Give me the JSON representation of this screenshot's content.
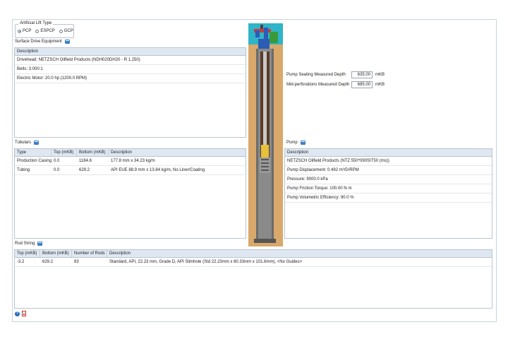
{
  "lift_type": {
    "title": "Artificial Lift Type",
    "options": [
      {
        "label": "PCP",
        "selected": true
      },
      {
        "label": "ESPCP",
        "selected": false
      },
      {
        "label": "GCP",
        "selected": false
      }
    ]
  },
  "surface": {
    "title": "Surface Drive Equipment",
    "header": "Description",
    "rows": [
      "Drivehead: NETZSCH Oilfield Products (NDH020DH20 - R 1.250)",
      "Belts: 3.000:1",
      "Electric Motor: 20.0 hp (1200.0 RPM)"
    ]
  },
  "depths": {
    "pump_seating": {
      "label": "Pump Seating Measured Depth",
      "value": "635.00",
      "unit": "mKB"
    },
    "mid_perf": {
      "label": "Mid-perforations Measured Depth",
      "value": "685.00",
      "unit": "mKB"
    }
  },
  "tubulars": {
    "title": "Tubulars",
    "headers": [
      "Type",
      "Top (mKB)",
      "Bottom (mKB)",
      "Description"
    ],
    "rows": [
      [
        "Production Casing",
        "0.0",
        "1184.6",
        "177.8 mm x 34.23 kg/m"
      ],
      [
        "Tubing",
        "0.0",
        "629.2",
        "API EUE 88.9 mm x 13.84 kg/m, No Liner/Coating"
      ]
    ]
  },
  "pump": {
    "title": "Pump",
    "header": "Description",
    "rows": [
      "NETZSCH Oilfield Products (NTZ 550*090SIT50 (ms))",
      "Pump Displacement: 0.492 m³/D/RPM",
      "Pressure: 9000.0 kPa",
      "Pump Friction Torque: 100.00 N·m",
      "Pump Volumetric Efficiency: 90.0 %"
    ]
  },
  "rod_string": {
    "title": "Rod String",
    "headers": [
      "Top (mKB)",
      "Bottom (mKB)",
      "Number of Rods",
      "Description"
    ],
    "rows": [
      [
        "-3.2",
        "629.2",
        "83",
        "Standard, API, 22.23 mm, Grade D, API Slimhole (Std 22.23mm x 60.33mm x 101.6mm), <No Guides>"
      ]
    ]
  },
  "icons": {
    "help": "help-icon",
    "pdf": "pdf-icon",
    "edit": "edit-icon"
  },
  "colors": {
    "header_bg": "#dfe8f2",
    "border": "#b8c4d0",
    "formation": "#d9a86b",
    "accent": "#2b6cc4"
  }
}
